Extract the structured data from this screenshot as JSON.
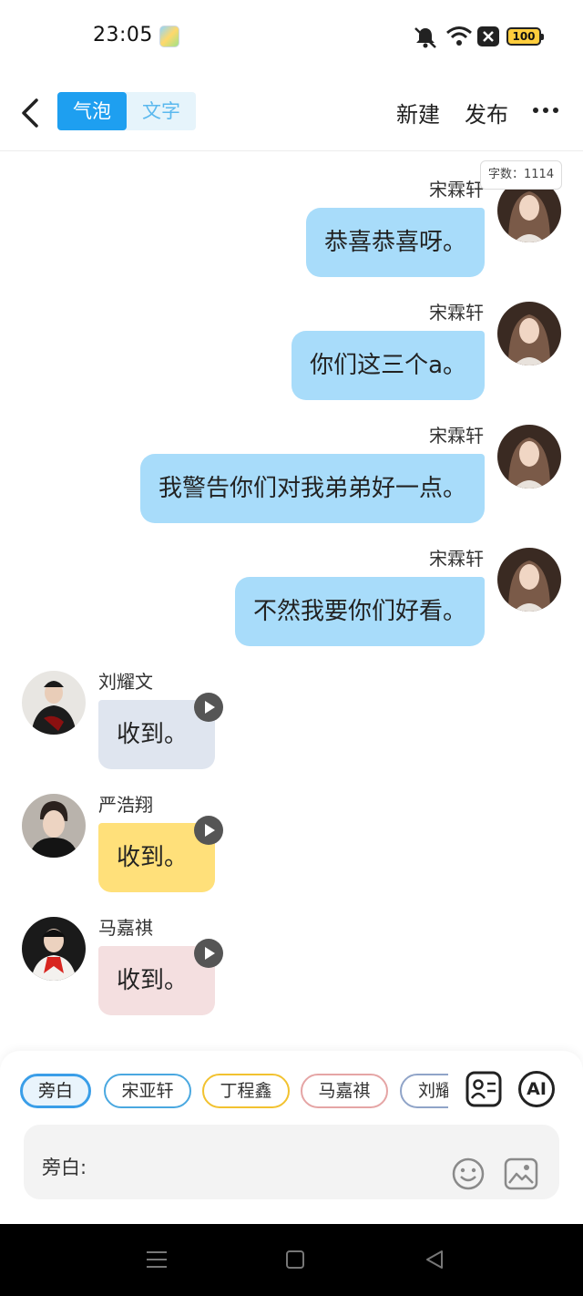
{
  "status_bar": {
    "time": "23:05",
    "battery": "100",
    "icons": [
      "app-icon",
      "mute-icon",
      "wifi-icon",
      "sim-off-icon",
      "battery-icon"
    ]
  },
  "header": {
    "tabs": [
      {
        "label": "气泡",
        "active": true
      },
      {
        "label": "文字",
        "active": false
      }
    ],
    "new_label": "新建",
    "publish_label": "发布"
  },
  "word_count": "字数：1114",
  "messages": [
    {
      "sender": "宋霖轩",
      "text": "恭喜恭喜呀。",
      "side": "right"
    },
    {
      "sender": "宋霖轩",
      "text": "你们这三个a。",
      "side": "right"
    },
    {
      "sender": "宋霖轩",
      "text": "我警告你们对我弟弟好一点。",
      "side": "right"
    },
    {
      "sender": "宋霖轩",
      "text": "不然我要你们好看。",
      "side": "right"
    },
    {
      "sender": "刘耀文",
      "text": "收到。",
      "side": "left",
      "color": "#dfe5ef"
    },
    {
      "sender": "严浩翔",
      "text": "收到。",
      "side": "left",
      "color": "#ffe07a"
    },
    {
      "sender": "马嘉祺",
      "text": "收到。",
      "side": "left",
      "color": "#f4dfe0"
    }
  ],
  "roles": [
    {
      "label": "旁白",
      "color": "#3a9ee8",
      "selected": true
    },
    {
      "label": "宋亚轩",
      "color": "#4aa8e0",
      "selected": false
    },
    {
      "label": "丁程鑫",
      "color": "#f2c230",
      "selected": false
    },
    {
      "label": "马嘉祺",
      "color": "#e5a5a5",
      "selected": false
    },
    {
      "label": "刘耀",
      "color": "#90a4c8",
      "selected": false
    }
  ],
  "toolbar": {
    "ai_label": "AI"
  },
  "input": {
    "label": "旁白:"
  },
  "colors": {
    "accent": "#1e9ff0",
    "bubble_right": "#a8dcfa"
  }
}
